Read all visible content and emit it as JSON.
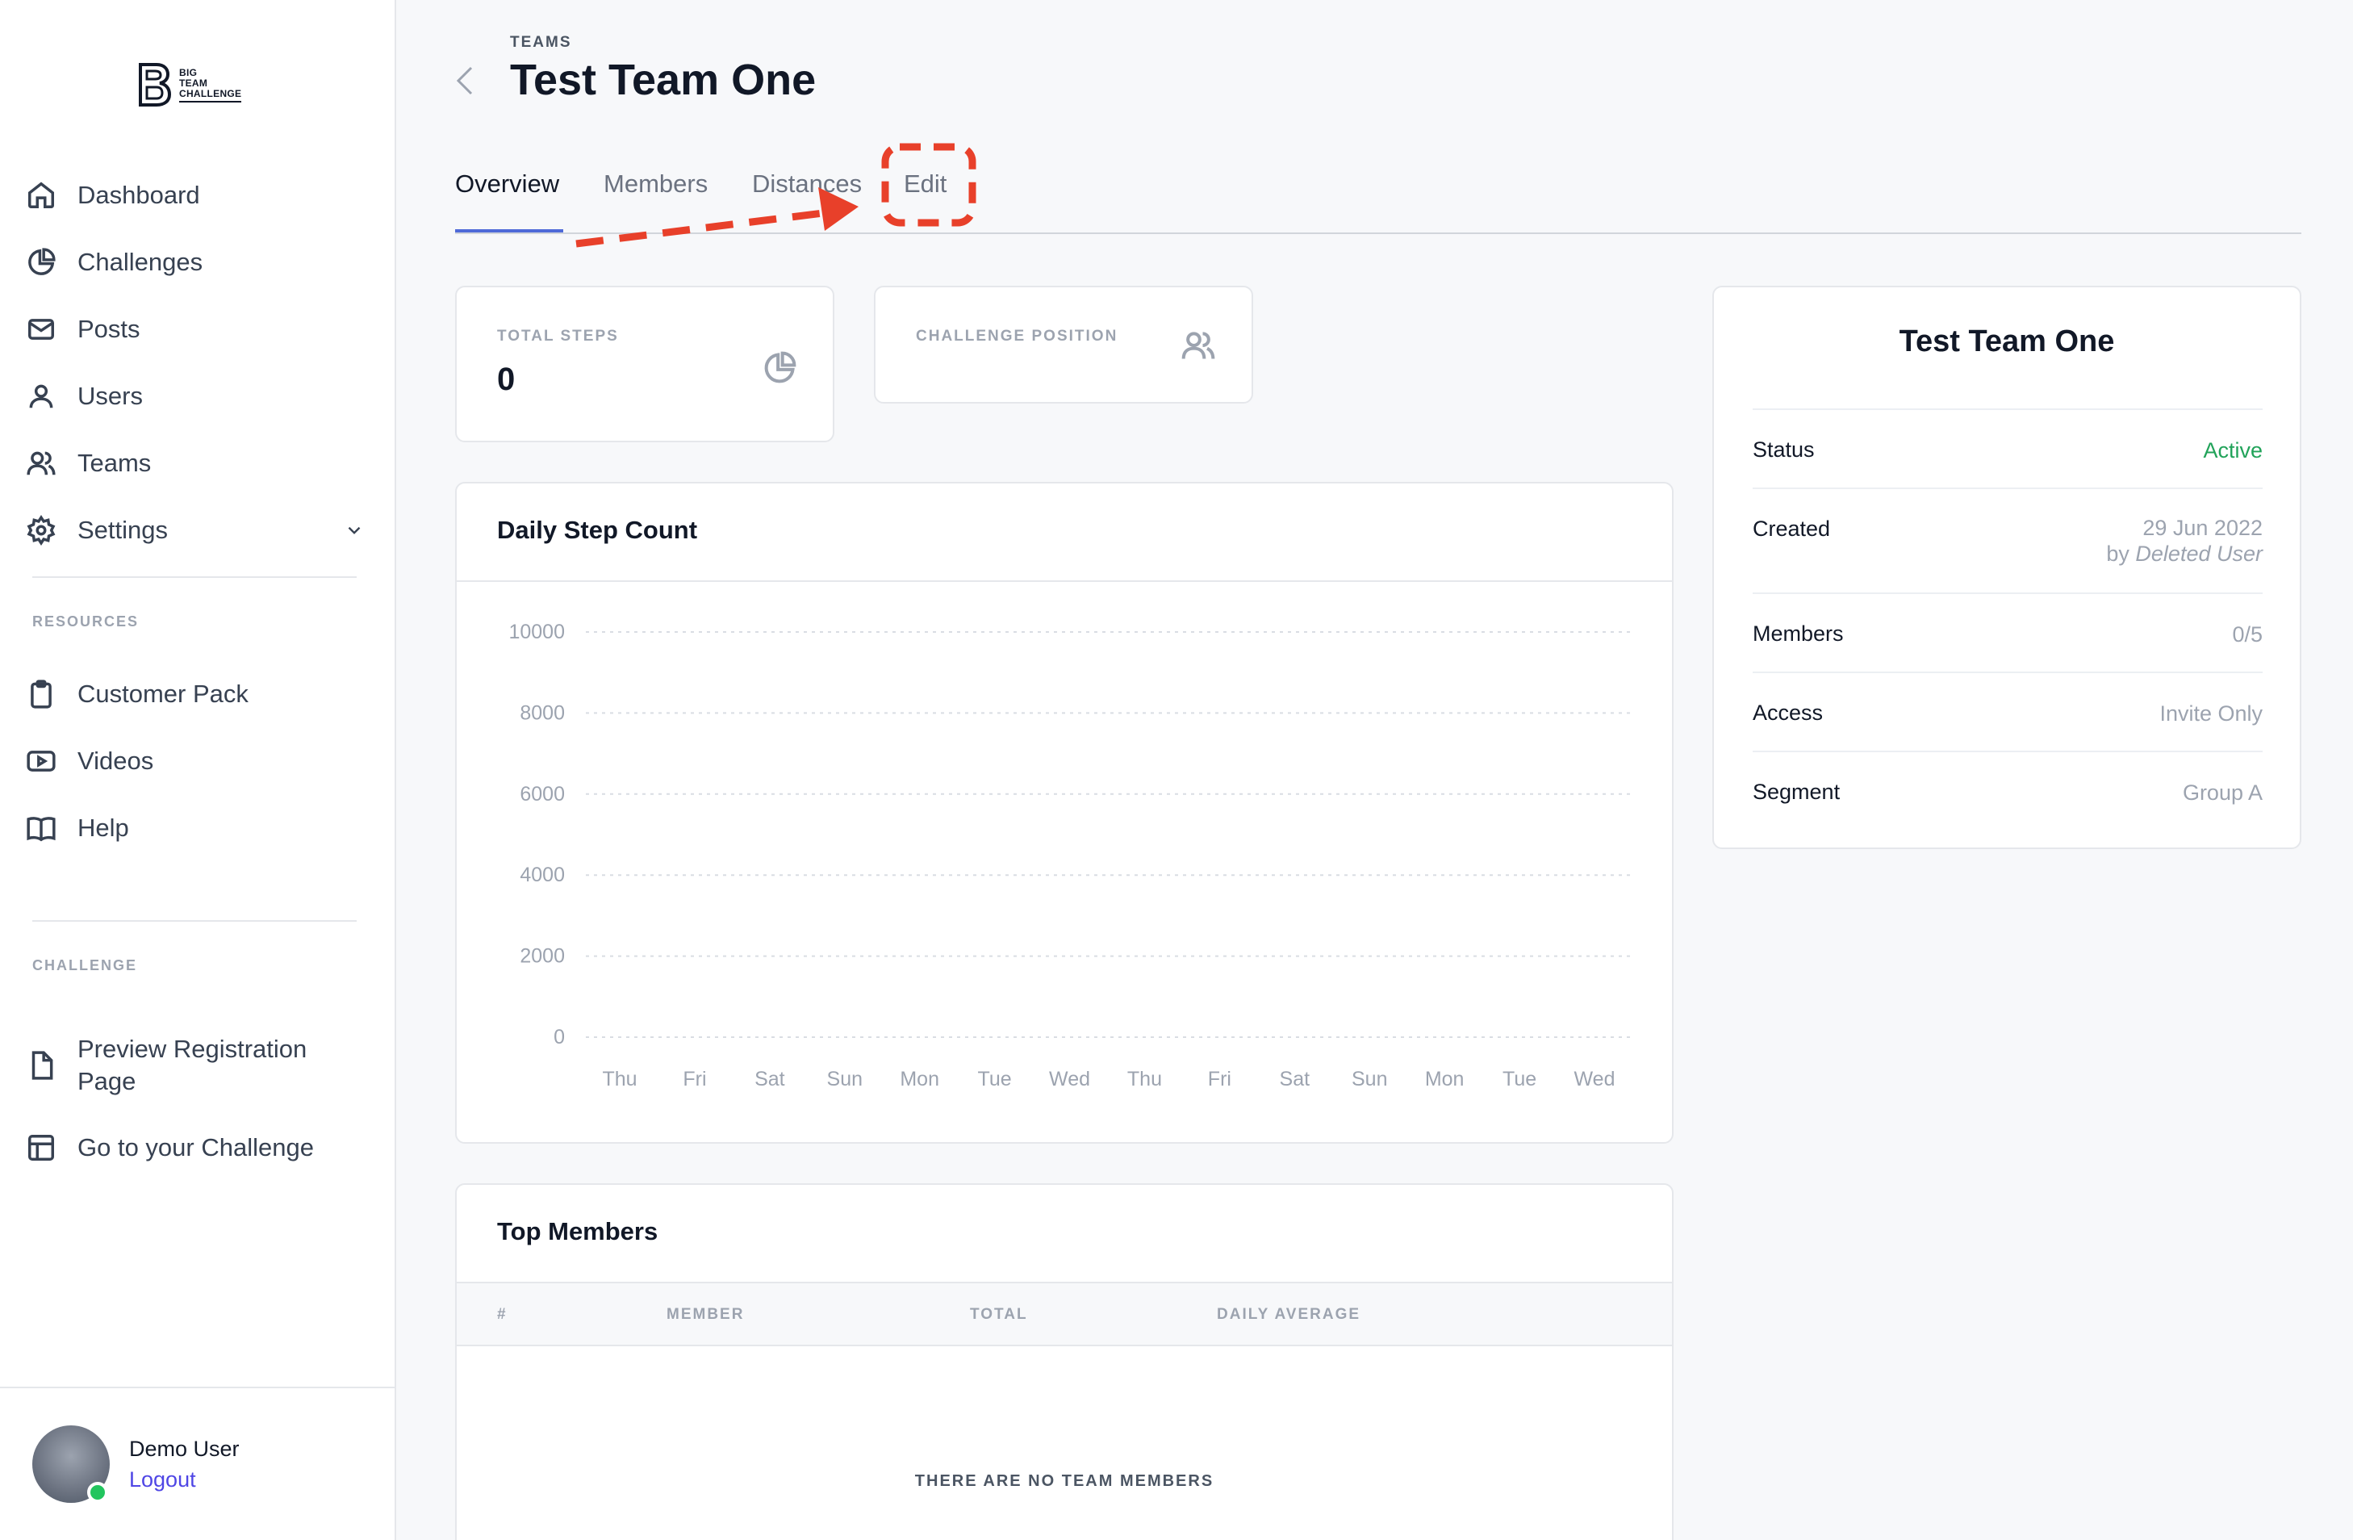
{
  "brand": {
    "logo_lines": [
      "BIG",
      "TEAM",
      "CHALLENGE"
    ]
  },
  "sidebar": {
    "nav": [
      {
        "label": "Dashboard",
        "icon": "home-icon"
      },
      {
        "label": "Challenges",
        "icon": "pie-chart-icon"
      },
      {
        "label": "Posts",
        "icon": "mail-icon"
      },
      {
        "label": "Users",
        "icon": "user-icon"
      },
      {
        "label": "Teams",
        "icon": "users-icon"
      },
      {
        "label": "Settings",
        "icon": "gear-icon"
      }
    ],
    "resources_title": "RESOURCES",
    "resources": [
      {
        "label": "Customer Pack",
        "icon": "clipboard-icon"
      },
      {
        "label": "Videos",
        "icon": "video-icon"
      },
      {
        "label": "Help",
        "icon": "book-icon"
      }
    ],
    "challenge_title": "CHALLENGE",
    "challenge": [
      {
        "label": "Preview Registration Page",
        "icon": "document-icon"
      },
      {
        "label": "Go to your Challenge",
        "icon": "layout-icon"
      }
    ],
    "user": {
      "name": "Demo User",
      "logout": "Logout",
      "status_color": "#22c55e"
    }
  },
  "header": {
    "breadcrumb": "TEAMS",
    "title": "Test Team One"
  },
  "tabs": [
    {
      "label": "Overview",
      "active": true
    },
    {
      "label": "Members",
      "active": false
    },
    {
      "label": "Distances",
      "active": false
    },
    {
      "label": "Edit",
      "active": false
    }
  ],
  "stats": {
    "total_steps": {
      "label": "TOTAL STEPS",
      "value": "0"
    },
    "challenge_position": {
      "label": "CHALLENGE POSITION",
      "value": ""
    }
  },
  "chart_data": {
    "type": "bar",
    "title": "Daily Step Count",
    "categories": [
      "Thu",
      "Fri",
      "Sat",
      "Sun",
      "Mon",
      "Tue",
      "Wed",
      "Thu",
      "Fri",
      "Sat",
      "Sun",
      "Mon",
      "Tue",
      "Wed"
    ],
    "values": [
      0,
      0,
      0,
      0,
      0,
      0,
      0,
      0,
      0,
      0,
      0,
      0,
      0,
      0
    ],
    "yticks": [
      10000,
      8000,
      6000,
      4000,
      2000,
      0
    ],
    "ylim": [
      0,
      10000
    ],
    "grid": true,
    "xlabel": "",
    "ylabel": ""
  },
  "top_members": {
    "title": "Top Members",
    "columns": [
      "#",
      "MEMBER",
      "TOTAL",
      "DAILY AVERAGE"
    ],
    "empty_text": "THERE ARE NO TEAM MEMBERS"
  },
  "team_info": {
    "title": "Test Team One",
    "rows": [
      {
        "key": "Status",
        "value": "Active"
      },
      {
        "key": "Created",
        "value": "29 Jun 2022",
        "value_by": "by",
        "value_user": "Deleted User"
      },
      {
        "key": "Members",
        "value": "0/5"
      },
      {
        "key": "Access",
        "value": "Invite Only"
      },
      {
        "key": "Segment",
        "value": "Group A"
      }
    ]
  },
  "colors": {
    "accent": "#4f6ad8",
    "annotation": "#e8402a",
    "status_active": "#22a35a"
  }
}
